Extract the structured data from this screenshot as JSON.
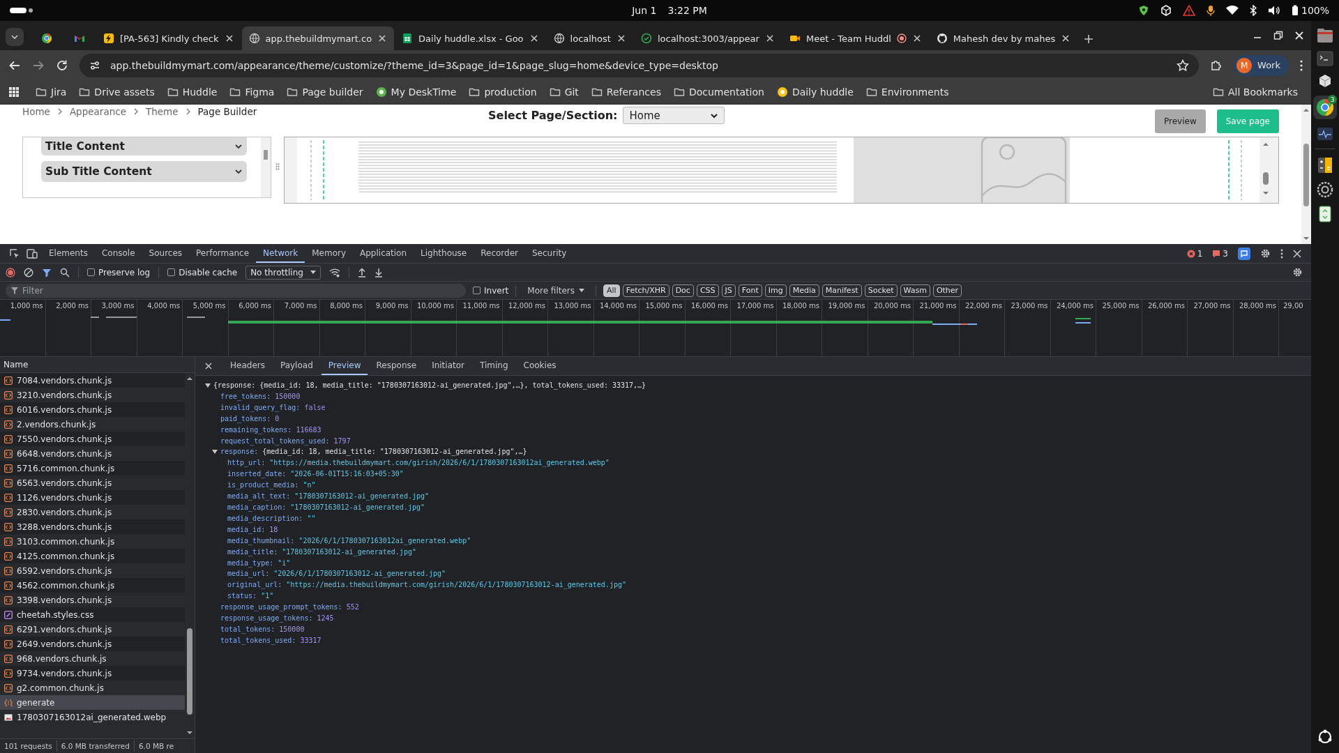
{
  "os_bar": {
    "date": "Jun 1",
    "time": "3:22 PM",
    "battery": "100%"
  },
  "tabs": [
    {
      "pinned": true,
      "selected": false,
      "recording": false
    },
    {
      "pinned": true,
      "selected": false,
      "recording": false
    },
    {
      "pinned": false,
      "title": "[PA-563] Kindly check",
      "selected": false,
      "recording": false
    },
    {
      "pinned": false,
      "title": "app.thebuildmymart.co",
      "selected": true,
      "recording": false
    },
    {
      "pinned": false,
      "title": "Daily huddle.xlsx - Goo",
      "selected": false,
      "recording": false
    },
    {
      "pinned": false,
      "title": "localhost",
      "selected": false,
      "recording": false
    },
    {
      "pinned": false,
      "title": "localhost:3003/appear",
      "selected": false,
      "recording": false
    },
    {
      "pinned": false,
      "title": "Meet - Team Huddl",
      "selected": false,
      "recording": true
    },
    {
      "pinned": false,
      "title": "Mahesh dev by mahes",
      "selected": false,
      "recording": false
    }
  ],
  "address_bar": {
    "url": "app.thebuildmymart.com/appearance/theme/customize/?theme_id=3&page_id=1&page_slug=home&device_type=desktop",
    "profile_initial": "M",
    "profile_label": "Work"
  },
  "bookmarks": [
    {
      "label": "Jira",
      "kind": "folder"
    },
    {
      "label": "Drive assets",
      "kind": "folder"
    },
    {
      "label": "Huddle",
      "kind": "folder"
    },
    {
      "label": "Figma",
      "kind": "folder"
    },
    {
      "label": "Page builder",
      "kind": "folder"
    },
    {
      "label": "My DeskTime",
      "kind": "site",
      "color": "#5fb34d"
    },
    {
      "label": "production",
      "kind": "folder"
    },
    {
      "label": "Git",
      "kind": "folder"
    },
    {
      "label": "Referances",
      "kind": "folder"
    },
    {
      "label": "Documentation",
      "kind": "folder"
    },
    {
      "label": "Daily huddle",
      "kind": "site",
      "color": "#f9c21b"
    },
    {
      "label": "Environments",
      "kind": "folder"
    }
  ],
  "all_bookmarks": "All Bookmarks",
  "page": {
    "breadcrumb": [
      "Home",
      "Appearance",
      "Theme",
      "Page Builder"
    ],
    "select_label": "Select Page/Section:",
    "select_value": "Home",
    "buttons": [
      {
        "label": "Preview",
        "kind": "secondary"
      },
      {
        "label": "Save page",
        "kind": "primary"
      }
    ],
    "sections": [
      {
        "title": "Title Content",
        "expanded": false
      },
      {
        "title": "Sub Title Content",
        "expanded": false
      }
    ]
  },
  "devtools": {
    "tabs": [
      {
        "label": "Elements",
        "selected": false
      },
      {
        "label": "Console",
        "selected": false
      },
      {
        "label": "Sources",
        "selected": false
      },
      {
        "label": "Performance",
        "selected": false
      },
      {
        "label": "Network",
        "selected": true
      },
      {
        "label": "Memory",
        "selected": false
      },
      {
        "label": "Application",
        "selected": false
      },
      {
        "label": "Lighthouse",
        "selected": false
      },
      {
        "label": "Recorder",
        "selected": false
      },
      {
        "label": "Security",
        "selected": false
      }
    ],
    "error_count": "1",
    "warning_count": "3",
    "toolbar": {
      "preserve_log": {
        "label": "Preserve log",
        "checked": false
      },
      "disable_cache": {
        "label": "Disable cache",
        "checked": false
      },
      "throttling": "No throttling"
    },
    "filter": {
      "placeholder": "Filter",
      "invert": {
        "label": "Invert",
        "checked": false
      },
      "more_filters": "More filters",
      "types": [
        {
          "label": "All",
          "selected": true
        },
        {
          "label": "Fetch/XHR",
          "selected": false
        },
        {
          "label": "Doc",
          "selected": false
        },
        {
          "label": "CSS",
          "selected": false
        },
        {
          "label": "JS",
          "selected": false
        },
        {
          "label": "Font",
          "selected": false
        },
        {
          "label": "Img",
          "selected": false
        },
        {
          "label": "Media",
          "selected": false
        },
        {
          "label": "Manifest",
          "selected": false
        },
        {
          "label": "Socket",
          "selected": false
        },
        {
          "label": "Wasm",
          "selected": false
        },
        {
          "label": "Other",
          "selected": false
        }
      ]
    },
    "timeline_ticks": [
      "1,000 ms",
      "2,000 ms",
      "3,000 ms",
      "4,000 ms",
      "5,000 ms",
      "6,000 ms",
      "7,000 ms",
      "8,000 ms",
      "9,000 ms",
      "10,000 ms",
      "11,000 ms",
      "12,000 ms",
      "13,000 ms",
      "14,000 ms",
      "15,000 ms",
      "16,000 ms",
      "17,000 ms",
      "18,000 ms",
      "19,000 ms",
      "20,000 ms",
      "21,000 ms",
      "22,000 ms",
      "23,000 ms",
      "24,000 ms",
      "25,000 ms",
      "26,000 ms",
      "27,000 ms",
      "28,000 ms",
      "29,00"
    ],
    "requests": {
      "header": "Name",
      "rows": [
        {
          "name": "7084.vendors.chunk.js",
          "kind": "script",
          "selected": false
        },
        {
          "name": "3210.vendors.chunk.js",
          "kind": "script",
          "selected": false
        },
        {
          "name": "6016.vendors.chunk.js",
          "kind": "script",
          "selected": false
        },
        {
          "name": "2.vendors.chunk.js",
          "kind": "script",
          "selected": false
        },
        {
          "name": "7550.vendors.chunk.js",
          "kind": "script",
          "selected": false
        },
        {
          "name": "6648.vendors.chunk.js",
          "kind": "script",
          "selected": false
        },
        {
          "name": "5716.common.chunk.js",
          "kind": "script",
          "selected": false
        },
        {
          "name": "6563.vendors.chunk.js",
          "kind": "script",
          "selected": false
        },
        {
          "name": "1126.vendors.chunk.js",
          "kind": "script",
          "selected": false
        },
        {
          "name": "2830.vendors.chunk.js",
          "kind": "script",
          "selected": false
        },
        {
          "name": "3288.vendors.chunk.js",
          "kind": "script",
          "selected": false
        },
        {
          "name": "3103.common.chunk.js",
          "kind": "script",
          "selected": false
        },
        {
          "name": "4125.common.chunk.js",
          "kind": "script",
          "selected": false
        },
        {
          "name": "6592.vendors.chunk.js",
          "kind": "script",
          "selected": false
        },
        {
          "name": "4562.common.chunk.js",
          "kind": "script",
          "selected": false
        },
        {
          "name": "3398.vendors.chunk.js",
          "kind": "script",
          "selected": false
        },
        {
          "name": "cheetah.styles.css",
          "kind": "stylesheet",
          "selected": false
        },
        {
          "name": "6291.vendors.chunk.js",
          "kind": "script",
          "selected": false
        },
        {
          "name": "2649.vendors.chunk.js",
          "kind": "script",
          "selected": false
        },
        {
          "name": "968.vendors.chunk.js",
          "kind": "script",
          "selected": false
        },
        {
          "name": "9734.vendors.chunk.js",
          "kind": "script",
          "selected": false
        },
        {
          "name": "g2.common.chunk.js",
          "kind": "script",
          "selected": false
        },
        {
          "name": "generate",
          "kind": "fetch",
          "selected": true
        },
        {
          "name": "1780307163012ai_generated.webp",
          "kind": "image",
          "selected": false
        }
      ]
    },
    "status": [
      "101 requests",
      "6.0 MB transferred",
      "6.0 MB re"
    ],
    "detail_tabs": [
      {
        "label": "Headers",
        "selected": false
      },
      {
        "label": "Payload",
        "selected": false
      },
      {
        "label": "Preview",
        "selected": true
      },
      {
        "label": "Response",
        "selected": false
      },
      {
        "label": "Initiator",
        "selected": false
      },
      {
        "label": "Timing",
        "selected": false
      },
      {
        "label": "Cookies",
        "selected": false
      }
    ],
    "preview": {
      "summary": "{response: {media_id: 18, media_title: \"1780307163012-ai_generated.jpg\",…}, total_tokens_used: 33317,…}",
      "expanded": true,
      "children": [
        {
          "label": "free_tokens:",
          "value": "150000",
          "kind": "number"
        },
        {
          "label": "invalid_query_flag:",
          "value": "false",
          "kind": "boolean"
        },
        {
          "label": "paid_tokens:",
          "value": "0",
          "kind": "number"
        },
        {
          "label": "remaining_tokens:",
          "value": "116683",
          "kind": "number"
        },
        {
          "label": "request_total_tokens_used:",
          "value": "1797",
          "kind": "number"
        },
        {
          "label": "response:",
          "kind": "object",
          "summary": "{media_id: 18, media_title: \"1780307163012-ai_generated.jpg\",…}",
          "expanded": true,
          "children": [
            {
              "label": "http_url:",
              "value": "\"https://media.thebuildmymart.com/girish/2026/6/1/1780307163012ai_generated.webp\"",
              "kind": "string"
            },
            {
              "label": "inserted_date:",
              "value": "\"2026-06-01T15:16:03+05:30\"",
              "kind": "string"
            },
            {
              "label": "is_product_media:",
              "value": "\"n\"",
              "kind": "string"
            },
            {
              "label": "media_alt_text:",
              "value": "\"1780307163012-ai_generated.jpg\"",
              "kind": "string"
            },
            {
              "label": "media_caption:",
              "value": "\"1780307163012-ai_generated.jpg\"",
              "kind": "string"
            },
            {
              "label": "media_description:",
              "value": "\"\"",
              "kind": "string"
            },
            {
              "label": "media_id:",
              "value": "18",
              "kind": "number"
            },
            {
              "label": "media_thumbnail:",
              "value": "\"2026/6/1/1780307163012ai_generated.webp\"",
              "kind": "string"
            },
            {
              "label": "media_title:",
              "value": "\"1780307163012-ai_generated.jpg\"",
              "kind": "string"
            },
            {
              "label": "media_type:",
              "value": "\"i\"",
              "kind": "string"
            },
            {
              "label": "media_url:",
              "value": "\"2026/6/1/1780307163012-ai_generated.jpg\"",
              "kind": "string"
            },
            {
              "label": "original_url:",
              "value": "\"https://media.thebuildmymart.com/girish/2026/6/1/1780307163012-ai_generated.jpg\"",
              "kind": "string"
            },
            {
              "label": "status:",
              "value": "\"1\"",
              "kind": "string"
            }
          ]
        },
        {
          "label": "response_usage_prompt_tokens:",
          "value": "552",
          "kind": "number"
        },
        {
          "label": "response_usage_tokens:",
          "value": "1245",
          "kind": "number"
        },
        {
          "label": "total_tokens:",
          "value": "150000",
          "kind": "number"
        },
        {
          "label": "total_tokens_used:",
          "value": "33317",
          "kind": "number"
        }
      ]
    }
  },
  "dock": {
    "badge": "3"
  }
}
